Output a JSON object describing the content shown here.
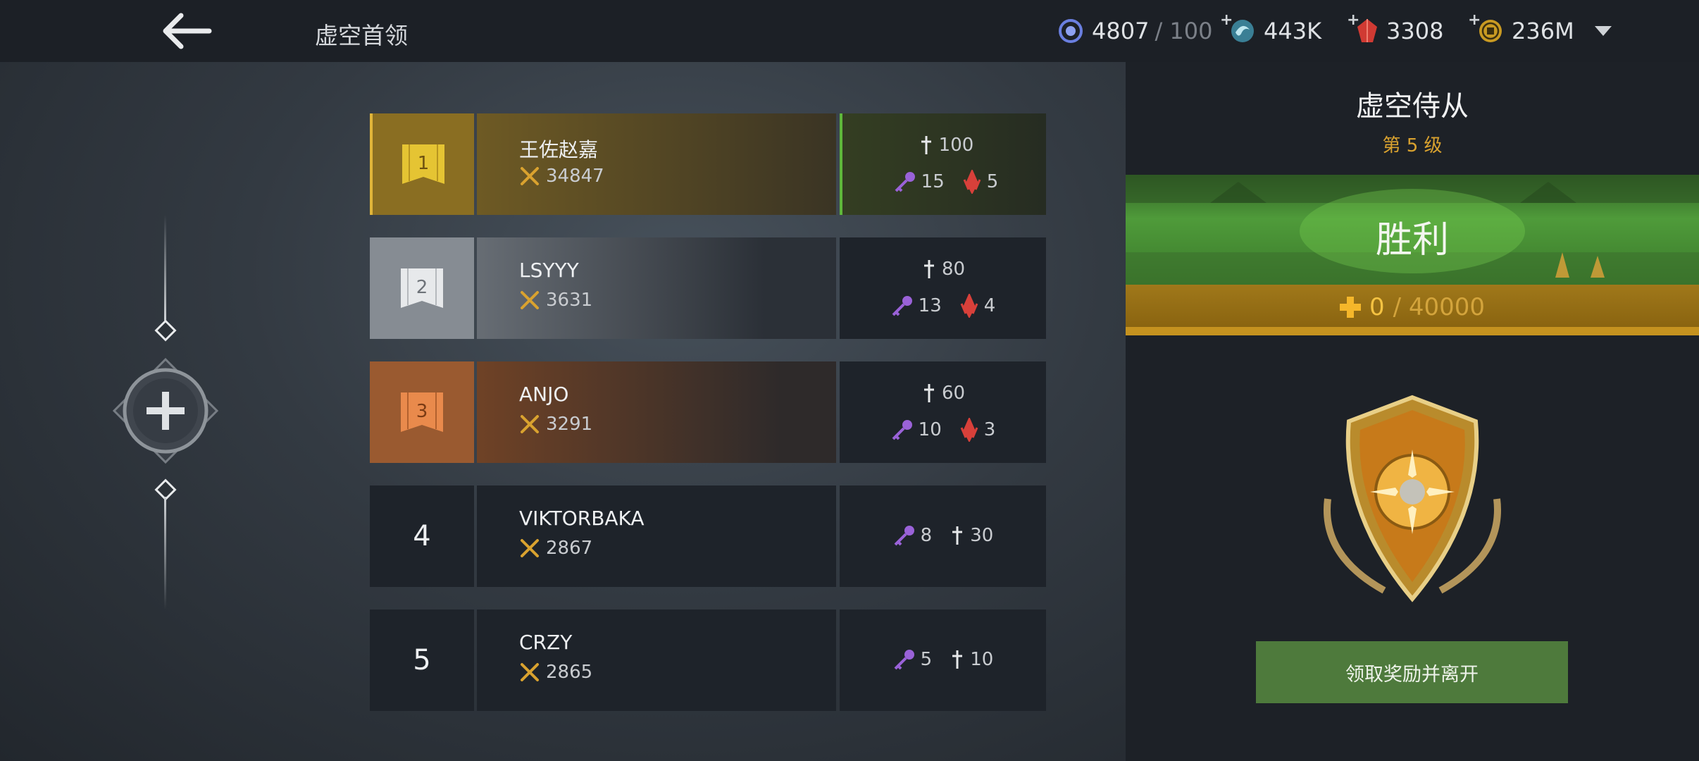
{
  "header": {
    "title": "虚空首领",
    "currencies": [
      {
        "icon": "void-orb-icon",
        "value": "4807",
        "cap": "/ 100",
        "plus": false
      },
      {
        "icon": "energy-swirl-icon",
        "value": "443K",
        "plus": true
      },
      {
        "icon": "red-gem-icon",
        "value": "3308",
        "plus": true
      },
      {
        "icon": "gold-coin-icon",
        "value": "236M",
        "plus": true
      }
    ]
  },
  "leaderboard": [
    {
      "rank": "1",
      "name": "王佐赵嘉",
      "power": "34847",
      "rewards": {
        "sword": "100",
        "key": "15",
        "crystal": "5"
      }
    },
    {
      "rank": "2",
      "name": "LSYYY",
      "power": "3631",
      "rewards": {
        "sword": "80",
        "key": "13",
        "crystal": "4"
      }
    },
    {
      "rank": "3",
      "name": "ANJO",
      "power": "3291",
      "rewards": {
        "sword": "60",
        "key": "10",
        "crystal": "3"
      }
    },
    {
      "rank": "4",
      "name": "VIKTORBAKA",
      "power": "2867",
      "rewards": {
        "key": "8",
        "sword": "30"
      }
    },
    {
      "rank": "5",
      "name": "CRZY",
      "power": "2865",
      "rewards": {
        "key": "5",
        "sword": "10"
      }
    }
  ],
  "result": {
    "boss_name": "虚空侍从",
    "level": "第 5 级",
    "outcome": "胜利",
    "progress_current": "0",
    "progress_max": "/ 40000",
    "claim_label": "领取奖励并离开"
  },
  "colors": {
    "accent_gold": "#d9a22f",
    "victory_green": "#4f9b3a",
    "button_green": "#4e7a3c",
    "key_purple": "#9a62d8",
    "crystal_red": "#d8403a"
  }
}
